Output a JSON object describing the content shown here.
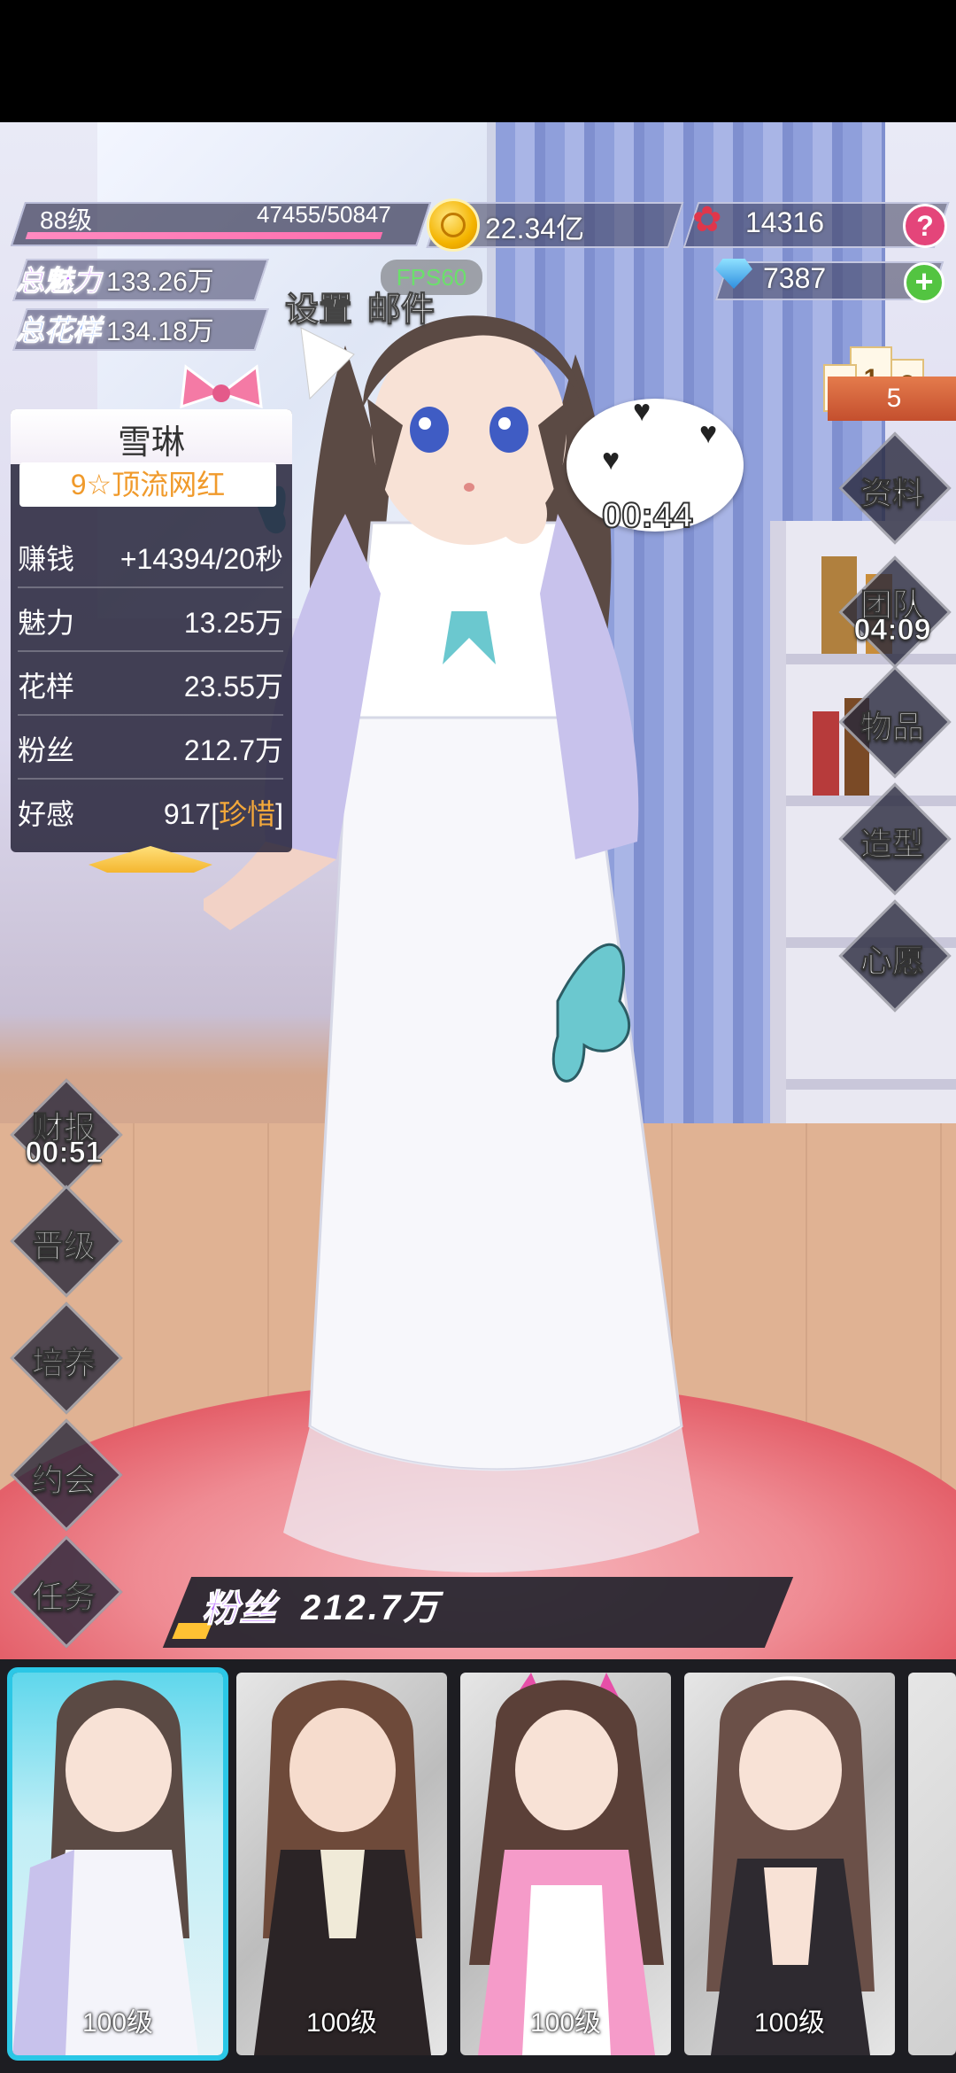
{
  "hud": {
    "level": "88级",
    "exp": "47455/50847",
    "exp_fraction": 0.933,
    "gold": "22.34亿",
    "roses": "14316",
    "diamonds": "7387",
    "help_label": "?",
    "add_label": "+",
    "total_charm_label": "总魅力",
    "total_charm_value": "133.26万",
    "total_style_label": "总花样",
    "total_style_value": "134.18万",
    "fps": "FPS60",
    "settings": "设置",
    "mail": "邮件"
  },
  "character": {
    "name": "雪琳",
    "title": "9☆顶流网红",
    "stats": [
      {
        "label": "赚钱",
        "value": "+14394/20秒"
      },
      {
        "label": "魅力",
        "value": "13.25万"
      },
      {
        "label": "花样",
        "value": "23.55万"
      },
      {
        "label": "粉丝",
        "value": "212.7万"
      },
      {
        "label": "好感",
        "value": "917[",
        "extra": "珍惜",
        "close": "]"
      }
    ],
    "bubble_timer": "00:44"
  },
  "ranking": {
    "first": "1",
    "second": "2",
    "third": "3",
    "count": "5"
  },
  "right_menu": {
    "profile": "资料",
    "team": "团队",
    "team_timer": "04:09",
    "items": "物品",
    "styling": "造型",
    "wish": "心愿"
  },
  "left_menu": {
    "finance": "财报",
    "finance_timer": "00:51",
    "promote": "晋级",
    "train": "培养",
    "date": "约会",
    "task": "任务"
  },
  "fans_bar": {
    "label": "粉丝",
    "value": "212.7万",
    "fraction": 0.06
  },
  "roster": [
    {
      "level": "100级",
      "selected": true
    },
    {
      "level": "100级",
      "selected": false
    },
    {
      "level": "100级",
      "selected": false
    },
    {
      "level": "100级",
      "selected": false
    }
  ],
  "colors": {
    "accent": "#2bc7e6",
    "pink": "#ff6fae",
    "gold": "#f4b400",
    "purple": "#b86cff"
  }
}
